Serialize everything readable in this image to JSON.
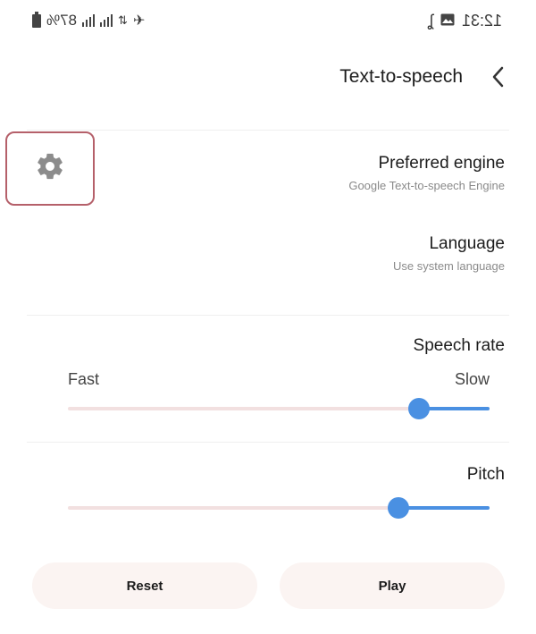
{
  "status_bar": {
    "battery_percent": "87%",
    "time": "12:31"
  },
  "header": {
    "title": "Text-to-speech"
  },
  "preferred_engine": {
    "title": "Preferred engine",
    "subtitle": "Google Text-to-speech Engine"
  },
  "language": {
    "title": "Language",
    "subtitle": "Use system language"
  },
  "speech_rate": {
    "title": "Speech rate",
    "min_label": "Slow",
    "max_label": "Fast",
    "value_fraction": 0.15
  },
  "pitch": {
    "title": "Pitch",
    "value_fraction": 0.2
  },
  "buttons": {
    "play": "Play",
    "reset": "Reset"
  },
  "colors": {
    "accent": "#4a90e2",
    "highlight_border": "#b5606a"
  }
}
